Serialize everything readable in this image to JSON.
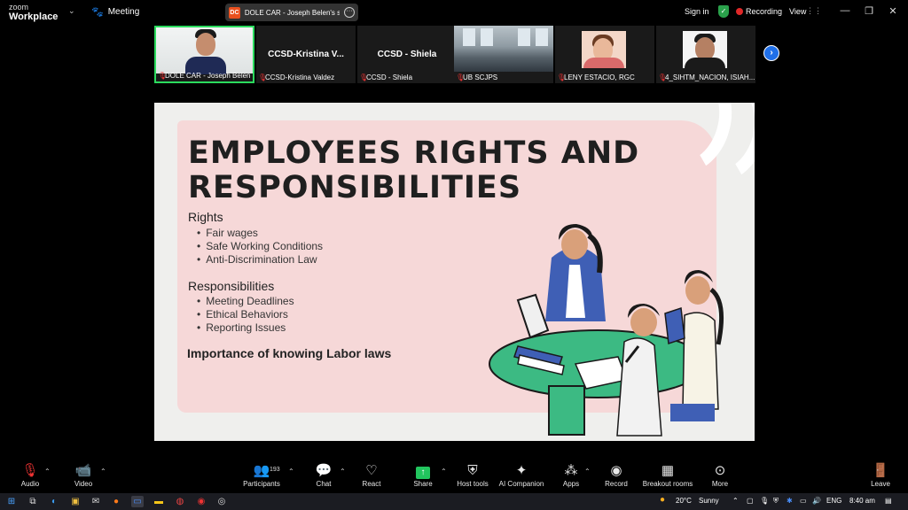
{
  "app": {
    "brand_small": "zoom",
    "brand_big": "Workplace",
    "meeting_label": "Meeting"
  },
  "share_pill": {
    "badge": "DC",
    "text": "DOLE CAR - Joseph Belen's scree"
  },
  "topbar": {
    "sign_in": "Sign in",
    "recording": "Recording",
    "view": "View"
  },
  "participants": [
    {
      "name": "DOLE CAR - Joseph Belen",
      "type": "video"
    },
    {
      "name": "CCSD-Kristina Valdez",
      "display": "CCSD-Kristina  V...",
      "type": "name"
    },
    {
      "name": "CCSD - Shiela",
      "display": "CCSD - Shiela",
      "type": "name"
    },
    {
      "name": "UB SCJPS",
      "type": "video"
    },
    {
      "name": "LENY ESTACIO, RGC",
      "type": "photo"
    },
    {
      "name": "4_SIHTM_NACION, ISIAH...",
      "type": "photo"
    }
  ],
  "slide": {
    "title_line1": "EMPLOYEES RIGHTS AND",
    "title_line2": "RESPONSIBILITIES",
    "rights_heading": "Rights",
    "rights": [
      "Fair wages",
      "Safe Working Conditions",
      "Anti-Discrimination Law"
    ],
    "resp_heading": "Responsibilities",
    "responsibilities": [
      "Meeting Deadlines",
      "Ethical Behaviors",
      "Reporting Issues"
    ],
    "importance": "Importance of knowing Labor laws"
  },
  "toolbar": {
    "audio": "Audio",
    "video": "Video",
    "participants": "Participants",
    "participant_count": "193",
    "chat": "Chat",
    "react": "React",
    "share": "Share",
    "host_tools": "Host tools",
    "ai_companion": "AI Companion",
    "apps": "Apps",
    "record": "Record",
    "breakout": "Breakout rooms",
    "more": "More",
    "leave": "Leave"
  },
  "taskbar": {
    "weather": "20°C",
    "weather_state": "Sunny",
    "lang": "ENG",
    "time": "8:40 am"
  },
  "colors": {
    "accent_green": "#2bdb5d",
    "recording_red": "#e02828",
    "slide_pink": "#f6d8d8",
    "next_blue": "#1f6fe8"
  }
}
